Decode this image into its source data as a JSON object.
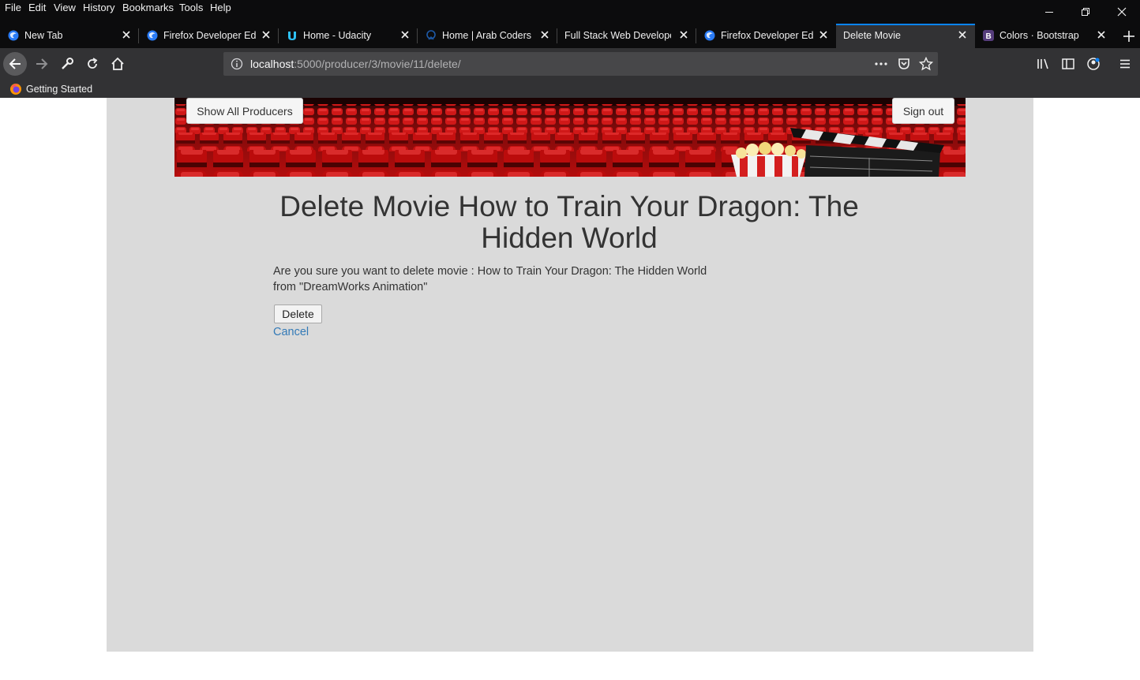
{
  "menu": [
    "File",
    "Edit",
    "View",
    "History",
    "Bookmarks",
    "Tools",
    "Help"
  ],
  "tabs": [
    {
      "label": "New Tab",
      "icon": "firefox-icon"
    },
    {
      "label": "Firefox Developer Edit",
      "icon": "firefox-dev-icon"
    },
    {
      "label": "Home - Udacity",
      "icon": "udacity-icon"
    },
    {
      "label": "Home | Arab Coders",
      "icon": "arab-coders-icon"
    },
    {
      "label": "Full Stack Web Developer",
      "icon": ""
    },
    {
      "label": "Firefox Developer Edit",
      "icon": "firefox-dev-icon"
    },
    {
      "label": "Delete Movie",
      "icon": "",
      "active": true
    },
    {
      "label": "Colors · Bootstrap",
      "icon": "bootstrap-icon"
    }
  ],
  "url": {
    "host": "localhost",
    "path": ":5000/producer/3/movie/11/delete/"
  },
  "bookmarks": {
    "getting_started": "Getting Started"
  },
  "header": {
    "show_all_producers": "Show All Producers",
    "sign_out": "Sign out"
  },
  "main": {
    "title": "Delete Movie How to Train Your Dragon: The Hidden World",
    "message_line1": "Are you sure you want to delete movie : How to Train Your Dragon: The Hidden World",
    "message_line2": "from \"DreamWorks Animation\"",
    "delete_label": "Delete",
    "cancel_label": "Cancel"
  },
  "colors": {
    "accent": "#0a84ff",
    "link": "#337ab7",
    "container_bg": "#dadada"
  }
}
